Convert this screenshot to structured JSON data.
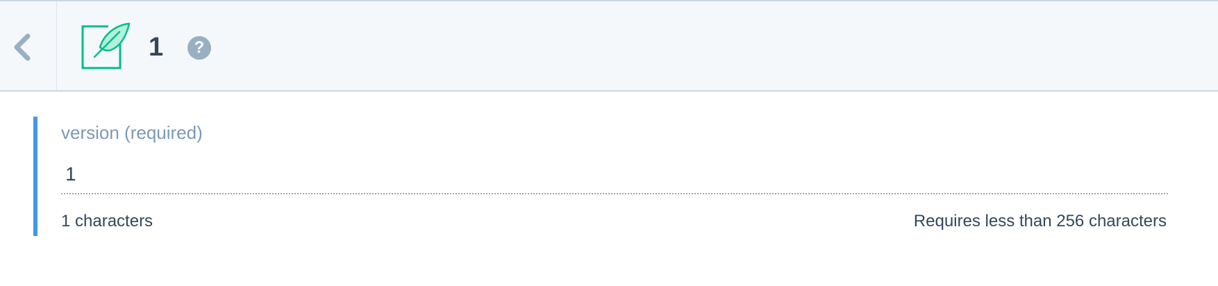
{
  "header": {
    "title": "1",
    "help_icon": "question-icon",
    "back_icon": "chevron-left-icon",
    "document_icon": "quill-document-icon"
  },
  "field": {
    "label": "version (required)",
    "value": "1",
    "char_count": "1 characters",
    "char_limit": "Requires less than 256 characters"
  },
  "colors": {
    "accent": "#4399e1",
    "icon_green": "#00bd8e",
    "text": "#33475b",
    "label": "#7c98b6",
    "help_icon": "#99afc4",
    "header_bg": "#f5f8fa"
  }
}
